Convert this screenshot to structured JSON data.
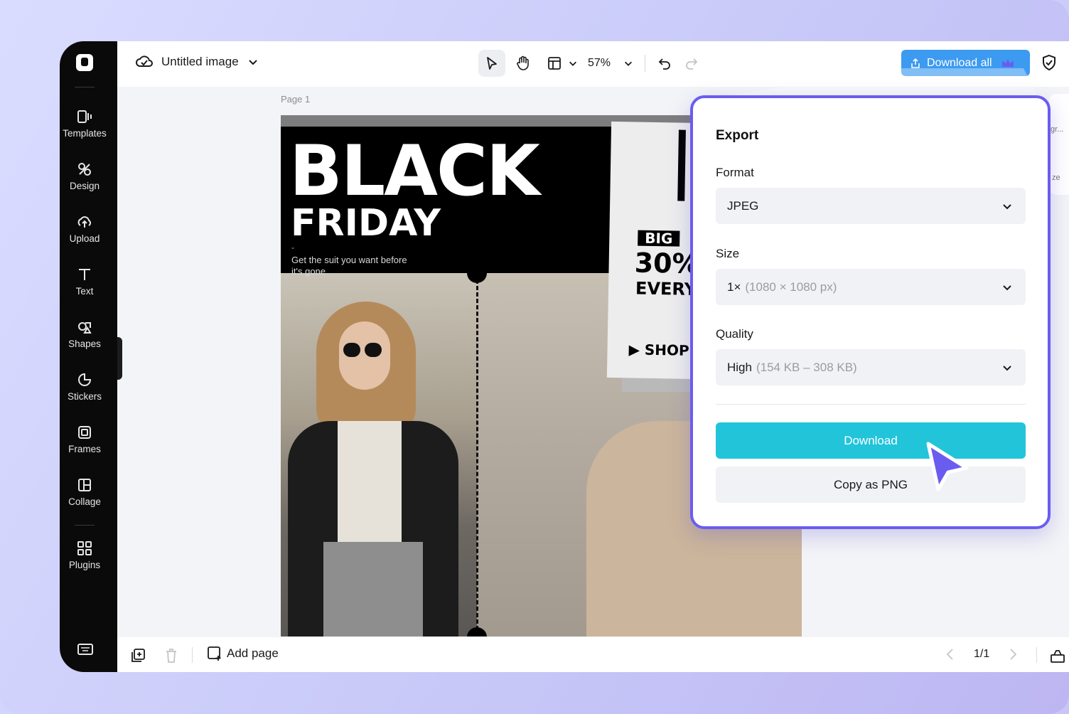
{
  "topbar": {
    "title": "Untitled image",
    "zoom": "57%",
    "download_all_label": "Download all"
  },
  "sidebar": {
    "items": [
      {
        "label": "Templates",
        "icon": "templates-icon"
      },
      {
        "label": "Design",
        "icon": "design-icon"
      },
      {
        "label": "Upload",
        "icon": "upload-icon"
      },
      {
        "label": "Text",
        "icon": "text-icon"
      },
      {
        "label": "Shapes",
        "icon": "shapes-icon"
      },
      {
        "label": "Stickers",
        "icon": "stickers-icon"
      },
      {
        "label": "Frames",
        "icon": "frames-icon"
      },
      {
        "label": "Collage",
        "icon": "collage-icon"
      },
      {
        "label": "Plugins",
        "icon": "plugins-icon"
      }
    ]
  },
  "canvas": {
    "page_label": "Page 1",
    "artwork": {
      "headline_1": "BLACK",
      "headline_2": "FRIDAY",
      "dash": "-",
      "tagline": "Get the suit you want before it's gone",
      "poster_big": "BIG",
      "poster_percent": "30%",
      "poster_every": "EVERY",
      "poster_shop": "▶ SHOP"
    }
  },
  "right_panel": {
    "label_1": "gr...",
    "label_2": "ze"
  },
  "export": {
    "title": "Export",
    "format_label": "Format",
    "format_value": "JPEG",
    "size_label": "Size",
    "size_value": "1×",
    "size_detail": "(1080 × 1080 px)",
    "quality_label": "Quality",
    "quality_value": "High",
    "quality_detail": "(154 KB – 308 KB)",
    "download_label": "Download",
    "copy_label": "Copy as PNG"
  },
  "bottombar": {
    "add_page_label": "Add page",
    "pager": "1/1"
  },
  "colors": {
    "accent_blue": "#3c9bf0",
    "download_cyan": "#22c4da",
    "popup_border": "#6b5cf0",
    "crown": "#6b5cf0"
  }
}
